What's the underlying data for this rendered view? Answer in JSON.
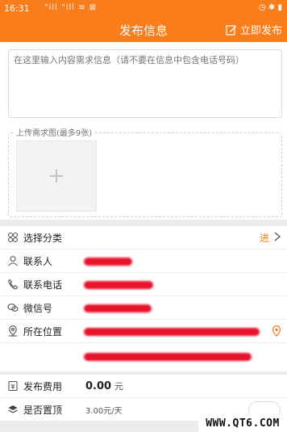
{
  "status_bar": {
    "time": "16:31",
    "network": "\"ill \"ill ≋ ⊠",
    "system": "◷ ✱ ▮"
  },
  "header": {
    "title": "发布信息",
    "publish_label": "立即发布",
    "accent": "#fa7d1c"
  },
  "content": {
    "placeholder": "在这里输入内容需求信息（请不要在信息中包含电话号码）"
  },
  "upload": {
    "label": "上传需求图(最多9张)",
    "add_symbol": "+"
  },
  "fields": {
    "category": {
      "label": "选择分类",
      "value": "进"
    },
    "contact": {
      "label": "联系人"
    },
    "phone": {
      "label": "联系电话"
    },
    "wechat": {
      "label": "微信号"
    },
    "location": {
      "label": "所在位置"
    }
  },
  "fee": {
    "label": "发布费用",
    "value": "0.00",
    "unit": "元"
  },
  "top": {
    "label": "是否置顶",
    "value": "3.00元/天"
  },
  "watermark": "WWW.QT6.COM",
  "icons": [
    "grid-icon",
    "person-icon",
    "phone-icon",
    "wechat-icon",
    "location-icon",
    "chevron-right-icon",
    "location-pin-icon",
    "coin-icon",
    "layers-icon",
    "edit-icon"
  ]
}
